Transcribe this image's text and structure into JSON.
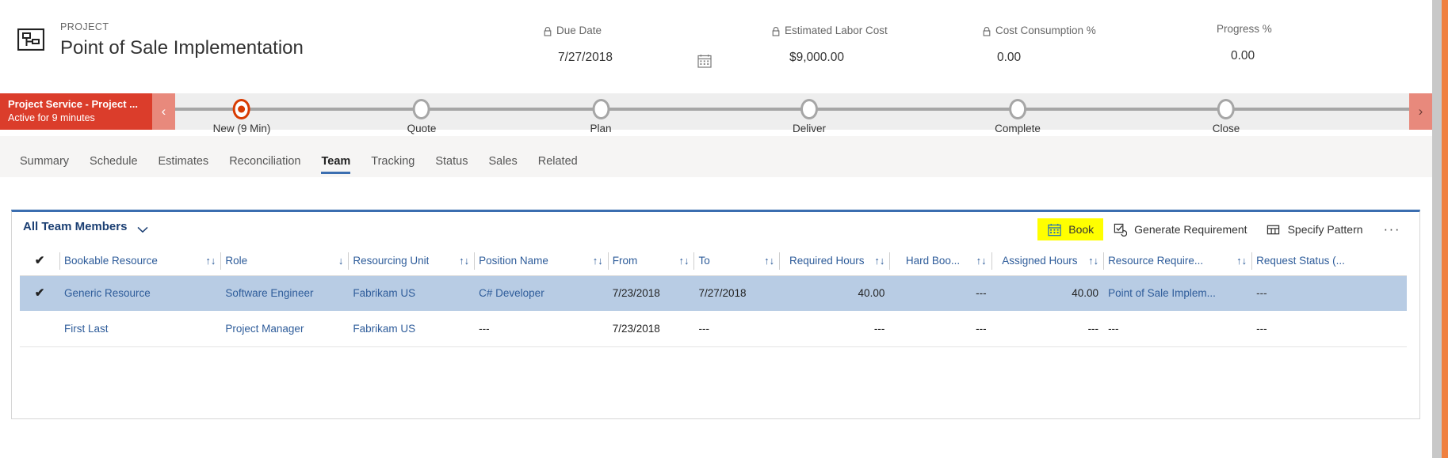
{
  "header": {
    "entity_type": "PROJECT",
    "record_title": "Point of Sale Implementation",
    "project_icon_name": "project-icon",
    "metrics": [
      {
        "label": "Due Date",
        "value": "7/27/2018",
        "locked": true
      },
      {
        "label": "Estimated Labor Cost",
        "value": "$9,000.00",
        "locked": true
      },
      {
        "label": "Cost Consumption %",
        "value": "0.00",
        "locked": true
      },
      {
        "label": "Progress %",
        "value": "0.00",
        "locked": false
      }
    ],
    "calendar_icon": "calendar-icon"
  },
  "process_flow": {
    "stage_title": "Project Service - Project ...",
    "stage_subtitle": "Active for 9 minutes",
    "prev_label": "‹",
    "next_label": "›",
    "stages": [
      {
        "label": "New  (9 Min)",
        "active": true
      },
      {
        "label": "Quote",
        "active": false
      },
      {
        "label": "Plan",
        "active": false
      },
      {
        "label": "Deliver",
        "active": false
      },
      {
        "label": "Complete",
        "active": false
      },
      {
        "label": "Close",
        "active": false
      }
    ],
    "accent_color": "#db3d2b",
    "active_node_color": "#d83b01"
  },
  "tabs": {
    "items": [
      {
        "label": "Summary",
        "selected": false
      },
      {
        "label": "Schedule",
        "selected": false
      },
      {
        "label": "Estimates",
        "selected": false
      },
      {
        "label": "Reconciliation",
        "selected": false
      },
      {
        "label": "Team",
        "selected": true
      },
      {
        "label": "Tracking",
        "selected": false
      },
      {
        "label": "Status",
        "selected": false
      },
      {
        "label": "Sales",
        "selected": false
      },
      {
        "label": "Related",
        "selected": false
      }
    ],
    "selected_underline_color": "#3b6eb0"
  },
  "grid": {
    "view_name": "All Team Members",
    "view_chevron_icon": "chevron-down-icon",
    "actions": [
      {
        "label": "Book",
        "icon": "calendar-icon",
        "highlighted": true,
        "highlight_color": "#ffff00"
      },
      {
        "label": "Generate Requirement",
        "icon": "checkbox-refresh-icon",
        "highlighted": false
      },
      {
        "label": "Specify Pattern",
        "icon": "grid-pattern-icon",
        "highlighted": false
      }
    ],
    "overflow_label": "···",
    "select_all_icon": "checkmark-icon",
    "columns": [
      {
        "label": "Bookable Resource",
        "sort": "both",
        "align": "left"
      },
      {
        "label": "Role",
        "sort": "desc",
        "align": "left"
      },
      {
        "label": "Resourcing Unit",
        "sort": "both",
        "align": "left"
      },
      {
        "label": "Position Name",
        "sort": "both",
        "align": "left"
      },
      {
        "label": "From",
        "sort": "both",
        "align": "left"
      },
      {
        "label": "To",
        "sort": "both",
        "align": "left"
      },
      {
        "label": "Required Hours",
        "sort": "both",
        "align": "right"
      },
      {
        "label": "Hard Boo...",
        "sort": "both",
        "align": "right"
      },
      {
        "label": "Assigned Hours",
        "sort": "both",
        "align": "right"
      },
      {
        "label": "Resource Require...",
        "sort": "both",
        "align": "left"
      },
      {
        "label": "Request Status (...",
        "sort": "none",
        "align": "left"
      }
    ],
    "sort_icon_both": "↑↓",
    "sort_icon_desc": "↓",
    "rows": [
      {
        "selected": true,
        "checked": true,
        "bookable_resource": "Generic Resource",
        "role": "Software Engineer",
        "resourcing_unit": "Fabrikam US",
        "position_name": "C# Developer",
        "from": "7/23/2018",
        "to": "7/27/2018",
        "required_hours": "40.00",
        "hard_booked": "---",
        "assigned_hours": "40.00",
        "resource_requirement": "Point of Sale Implem...",
        "request_status": "---"
      },
      {
        "selected": false,
        "checked": false,
        "bookable_resource": "First Last",
        "role": "Project Manager",
        "resourcing_unit": "Fabrikam US",
        "position_name": "---",
        "from": "7/23/2018",
        "to": "---",
        "required_hours": "---",
        "hard_booked": "---",
        "assigned_hours": "---",
        "resource_requirement": "---",
        "request_status": "---"
      }
    ]
  }
}
